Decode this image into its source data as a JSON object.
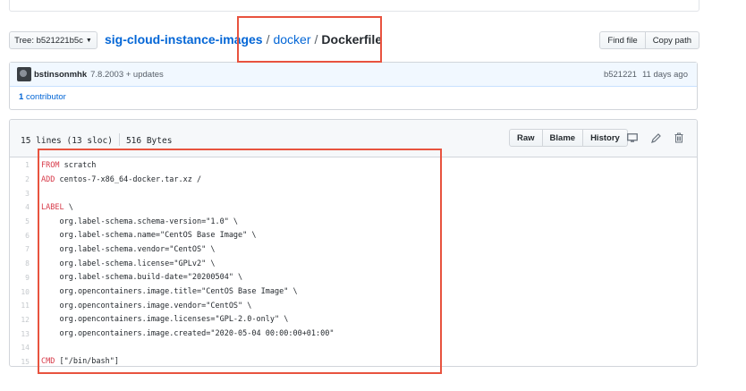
{
  "breadcrumb": {
    "tree_label": "Tree: b521221b5c",
    "repo": "sig-cloud-instance-images",
    "sep1": "/",
    "dir": "docker",
    "sep2": "/",
    "file": "Dockerfile"
  },
  "file_nav": {
    "find_file": "Find file",
    "copy_path": "Copy path"
  },
  "commit": {
    "author": "bstinsonmhk",
    "message": "7.8.2003 + updates",
    "sha": "b521221",
    "time": "11 days ago",
    "contributors_count": "1",
    "contributors_label": "contributor"
  },
  "file": {
    "lines_info": "15 lines (13 sloc)",
    "size": "516 Bytes",
    "actions": {
      "raw": "Raw",
      "blame": "Blame",
      "history": "History"
    },
    "icons": [
      "desktop-icon",
      "pencil-icon",
      "trash-icon"
    ]
  },
  "code_lines": [
    {
      "n": "1",
      "kw": "FROM",
      "rest": " scratch"
    },
    {
      "n": "2",
      "kw": "ADD",
      "rest": " centos-7-x86_64-docker.tar.xz /"
    },
    {
      "n": "3",
      "kw": "",
      "rest": ""
    },
    {
      "n": "4",
      "kw": "LABEL",
      "rest": " \\"
    },
    {
      "n": "5",
      "kw": "",
      "rest": "    org.label-schema.schema-version=\"1.0\" \\"
    },
    {
      "n": "6",
      "kw": "",
      "rest": "    org.label-schema.name=\"CentOS Base Image\" \\"
    },
    {
      "n": "7",
      "kw": "",
      "rest": "    org.label-schema.vendor=\"CentOS\" \\"
    },
    {
      "n": "8",
      "kw": "",
      "rest": "    org.label-schema.license=\"GPLv2\" \\"
    },
    {
      "n": "9",
      "kw": "",
      "rest": "    org.label-schema.build-date=\"20200504\" \\"
    },
    {
      "n": "10",
      "kw": "",
      "rest": "    org.opencontainers.image.title=\"CentOS Base Image\" \\"
    },
    {
      "n": "11",
      "kw": "",
      "rest": "    org.opencontainers.image.vendor=\"CentOS\" \\"
    },
    {
      "n": "12",
      "kw": "",
      "rest": "    org.opencontainers.image.licenses=\"GPL-2.0-only\" \\"
    },
    {
      "n": "13",
      "kw": "",
      "rest": "    org.opencontainers.image.created=\"2020-05-04 00:00:00+01:00\""
    },
    {
      "n": "14",
      "kw": "",
      "rest": ""
    },
    {
      "n": "15",
      "kw": "CMD",
      "rest": " [\"/bin/bash\"]"
    }
  ],
  "colors": {
    "link": "#0366d6",
    "keyword": "#d73a49",
    "highlight": "#e8533f"
  }
}
